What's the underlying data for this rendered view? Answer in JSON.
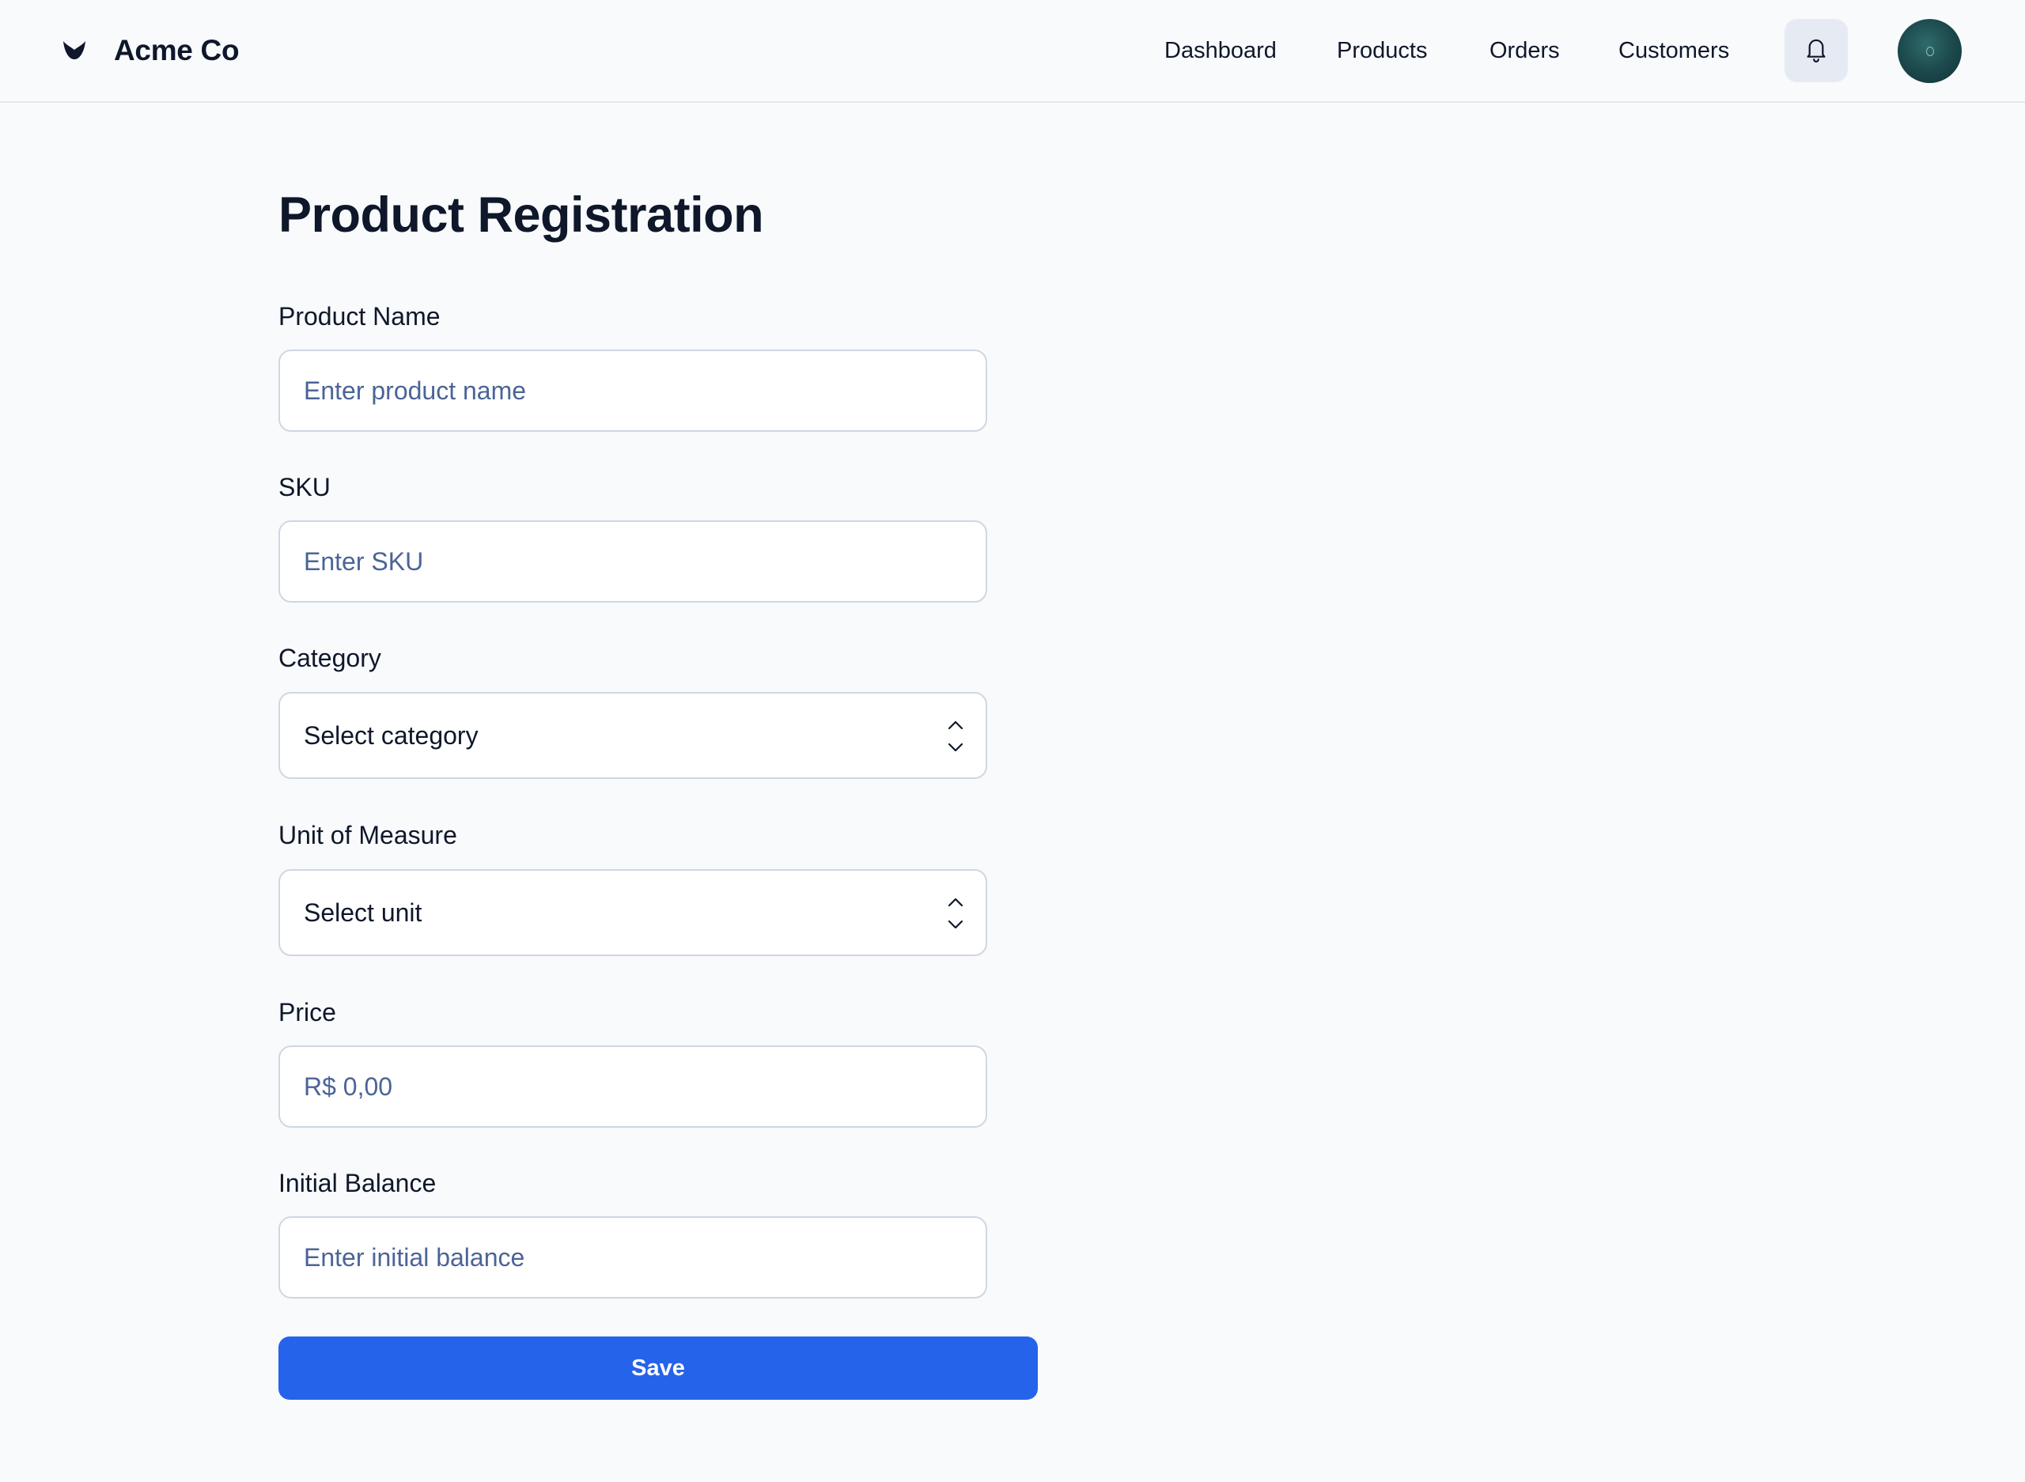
{
  "header": {
    "brand_name": "Acme Co",
    "brand_icon": "acme-leaf-logo",
    "nav": [
      {
        "label": "Dashboard"
      },
      {
        "label": "Products"
      },
      {
        "label": "Orders"
      },
      {
        "label": "Customers"
      }
    ],
    "notification_icon": "bell-icon",
    "avatar_icon": "user-avatar"
  },
  "page": {
    "title": "Product Registration"
  },
  "form": {
    "product_name": {
      "label": "Product Name",
      "placeholder": "Enter product name",
      "value": ""
    },
    "sku": {
      "label": "SKU",
      "placeholder": "Enter SKU",
      "value": ""
    },
    "category": {
      "label": "Category",
      "selected": "Select category",
      "icon": "chevron-up-down-icon"
    },
    "unit": {
      "label": "Unit of Measure",
      "selected": "Select unit",
      "icon": "chevron-up-down-icon"
    },
    "price": {
      "label": "Price",
      "placeholder": "R$ 0,00",
      "value": ""
    },
    "initial_balance": {
      "label": "Initial Balance",
      "placeholder": "Enter initial balance",
      "value": ""
    },
    "save_label": "Save"
  },
  "colors": {
    "accent": "#2563eb",
    "background": "#f8fafc",
    "placeholder": "#4b6497",
    "border": "#cfd7e3"
  }
}
